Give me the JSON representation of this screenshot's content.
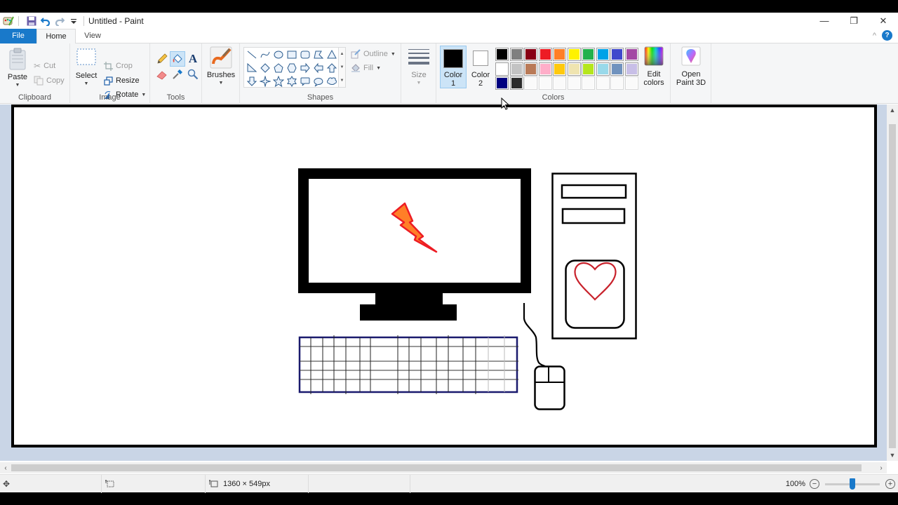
{
  "window": {
    "title": "Untitled - Paint",
    "controls": {
      "minimize": "—",
      "maximize": "❐",
      "close": "✕"
    }
  },
  "quick_access": {
    "icons": [
      "paint-app-icon",
      "save-icon",
      "undo-icon",
      "redo-icon",
      "customize-dropdown-icon"
    ]
  },
  "tabs": [
    {
      "label": "File",
      "active": false
    },
    {
      "label": "Home",
      "active": true
    },
    {
      "label": "View",
      "active": false
    }
  ],
  "help": {
    "collapse_glyph": "^",
    "help_glyph": "?"
  },
  "ribbon": {
    "clipboard": {
      "label": "Clipboard",
      "paste": "Paste",
      "cut": "Cut",
      "copy": "Copy"
    },
    "image": {
      "label": "Image",
      "select": "Select",
      "crop": "Crop",
      "resize": "Resize",
      "rotate": "Rotate"
    },
    "tools": {
      "label": "Tools",
      "items": [
        "pencil",
        "fill",
        "text",
        "eraser",
        "color-picker",
        "magnifier"
      ],
      "active": "fill"
    },
    "brushes": {
      "label": "Brushes"
    },
    "shapes": {
      "label": "Shapes",
      "items": [
        "line",
        "curve",
        "oval",
        "rectangle",
        "rounded-rectangle",
        "polygon",
        "triangle",
        "right-triangle",
        "diamond",
        "pentagon",
        "hexagon",
        "right-arrow",
        "left-arrow",
        "up-arrow",
        "down-arrow",
        "four-point-star",
        "five-point-star",
        "six-point-star",
        "rounded-callout",
        "oval-callout",
        "cloud-callout"
      ],
      "outline": "Outline",
      "fill": "Fill"
    },
    "size": {
      "label": "Size"
    },
    "colors": {
      "label": "Colors",
      "color1": {
        "label_line1": "Color",
        "label_line2": "1",
        "value": "#000000"
      },
      "color2": {
        "label_line1": "Color",
        "label_line2": "2",
        "value": "#ffffff"
      },
      "palette": [
        "#000000",
        "#7f7f7f",
        "#880015",
        "#ed1c24",
        "#ff7f27",
        "#fff200",
        "#22b14c",
        "#00a2e8",
        "#3f48cc",
        "#a349a4",
        "#ffffff",
        "#c3c3c3",
        "#b97a57",
        "#ffaec9",
        "#ffc90e",
        "#efe4b0",
        "#b5e61d",
        "#99d9ea",
        "#7092be",
        "#c8bfe7",
        "#000080",
        "#2b2b2b",
        "",
        "",
        "",
        "",
        "",
        "",
        "",
        ""
      ],
      "edit_colors_line1": "Edit",
      "edit_colors_line2": "colors"
    },
    "paint3d": {
      "line1": "Open",
      "line2": "Paint 3D"
    }
  },
  "canvas_drawing": {
    "subject": "desktop computer",
    "elements": [
      "monitor",
      "lightning-bolt",
      "monitor-stand",
      "tower",
      "drive-bays",
      "heart-logo",
      "keyboard",
      "mouse",
      "mouse-cable"
    ],
    "colors": {
      "outline": "#000000",
      "bolt_fill": "#ff7f27",
      "bolt_stroke": "#ed1c24",
      "heart": "#c8212b",
      "keyboard_border": "#1a1a6e"
    }
  },
  "statusbar": {
    "selection_size": "",
    "image_size": "1360 × 549px",
    "zoom_label": "100%",
    "zoom_percent": 100
  }
}
